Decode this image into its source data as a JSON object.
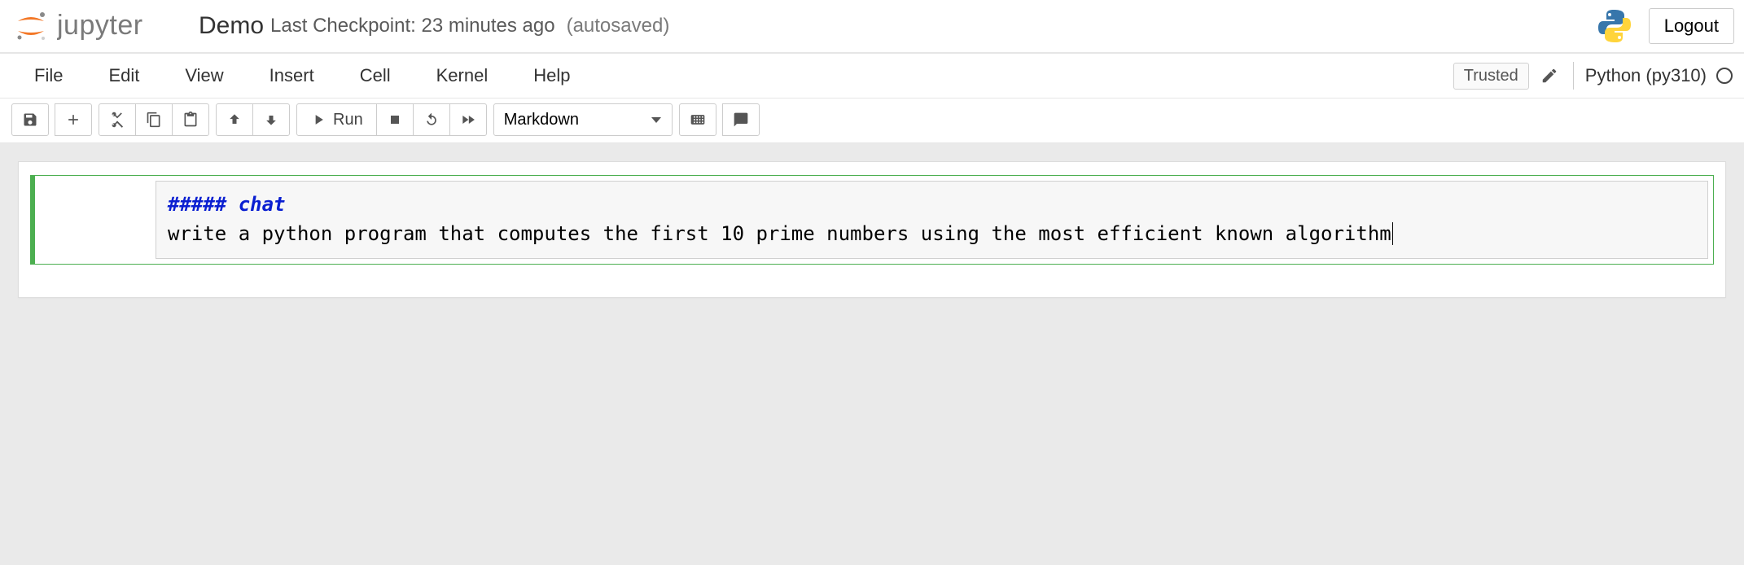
{
  "header": {
    "brand_text": "jupyter",
    "title": "Demo",
    "checkpoint": "Last Checkpoint: 23 minutes ago",
    "autosave": "(autosaved)",
    "logout": "Logout"
  },
  "menus": {
    "file": "File",
    "edit": "Edit",
    "view": "View",
    "insert": "Insert",
    "cell": "Cell",
    "kernel": "Kernel",
    "help": "Help"
  },
  "topright": {
    "trusted": "Trusted",
    "kernel": "Python (py310)"
  },
  "toolbar": {
    "run_label": "Run",
    "cell_type": "Markdown"
  },
  "cell0": {
    "heading": "##### chat",
    "body": "write a python program that computes the first 10 prime numbers using the most efficient known algorithm"
  }
}
